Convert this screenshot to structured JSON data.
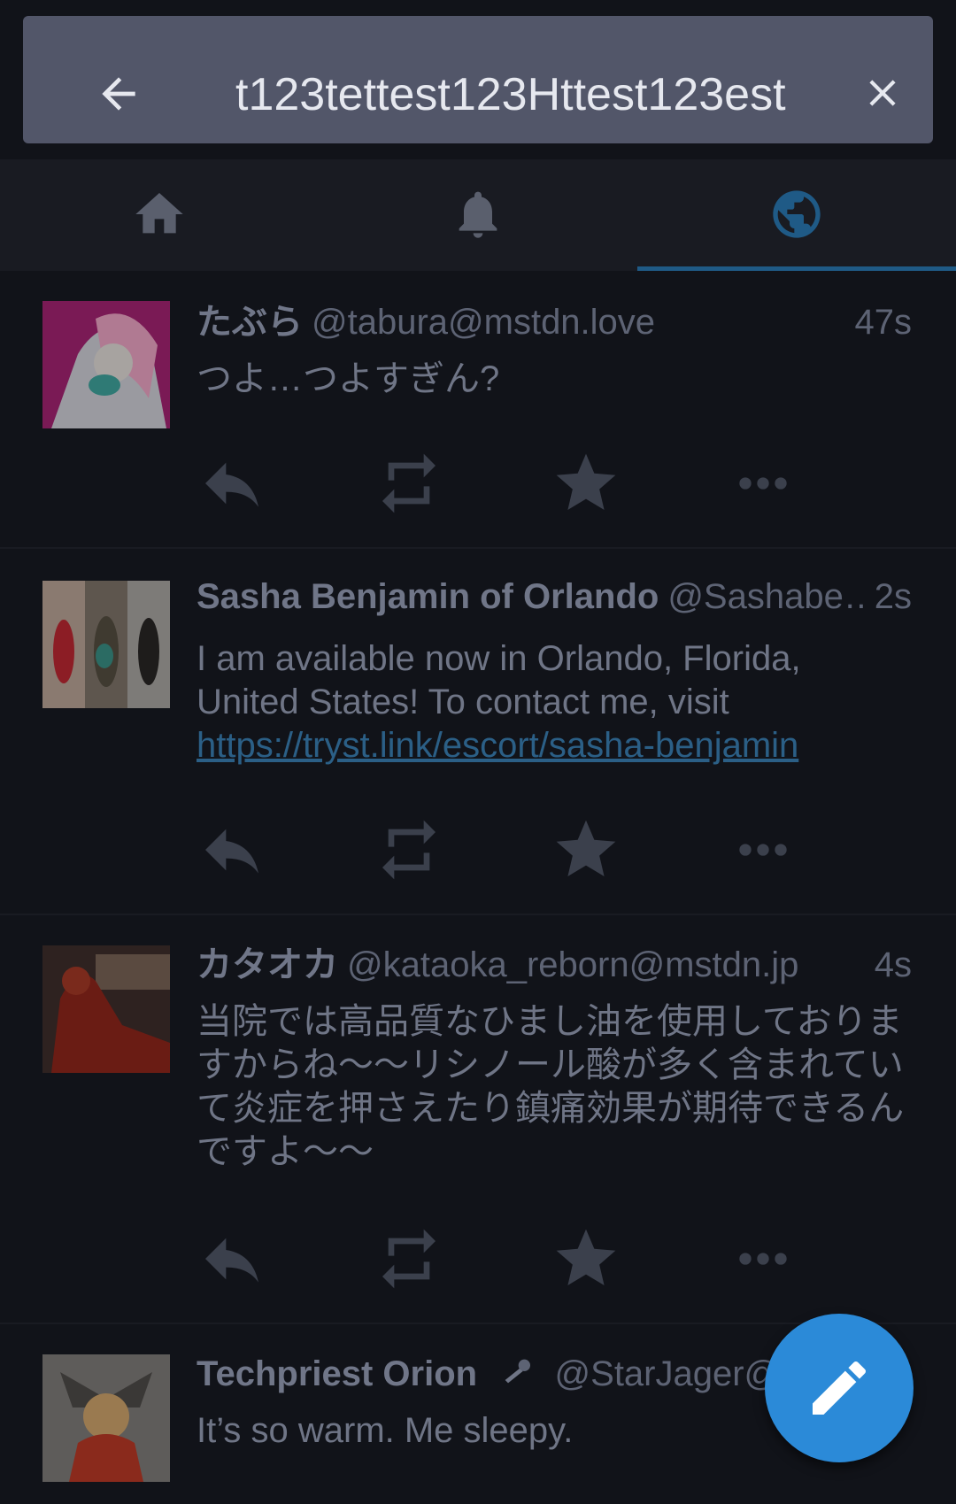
{
  "search": {
    "value": "t123tettest123Httest123est"
  },
  "tabs": [
    {
      "name": "home",
      "icon": "home-icon"
    },
    {
      "name": "notifications",
      "icon": "bell-icon"
    },
    {
      "name": "federated",
      "icon": "globe-icon",
      "active": true
    }
  ],
  "statuses": [
    {
      "display_name": "たぶら",
      "handle": "@tabura@mstdn.love",
      "time": "47s",
      "content": "つよ…つよすぎん?"
    },
    {
      "display_name": "Sasha Benjamin of Orlando",
      "handle": "@Sashabe…",
      "time": "2s",
      "content": "I am available now in Orlando, Florida, United States! To contact me, visit ",
      "link": "https://tryst.link/escort/sasha-benjamin"
    },
    {
      "display_name": "カタオカ",
      "handle": "@kataoka_reborn@mstdn.jp",
      "time": "4s",
      "content": "当院では高品質なひまし油を使用しておりますからね〜〜リシノール酸が多く含まれていて炎症を押さえたり鎮痛効果が期待できるんですよ〜〜"
    },
    {
      "display_name": "Techpriest Orion",
      "handle": "@StarJager@",
      "time": "",
      "content": "It’s so warm. Me sleepy."
    }
  ],
  "colors": {
    "accent": "#2b8ad8",
    "link": "#2b5f86",
    "search_bg": "#525669",
    "background": "#111319"
  }
}
